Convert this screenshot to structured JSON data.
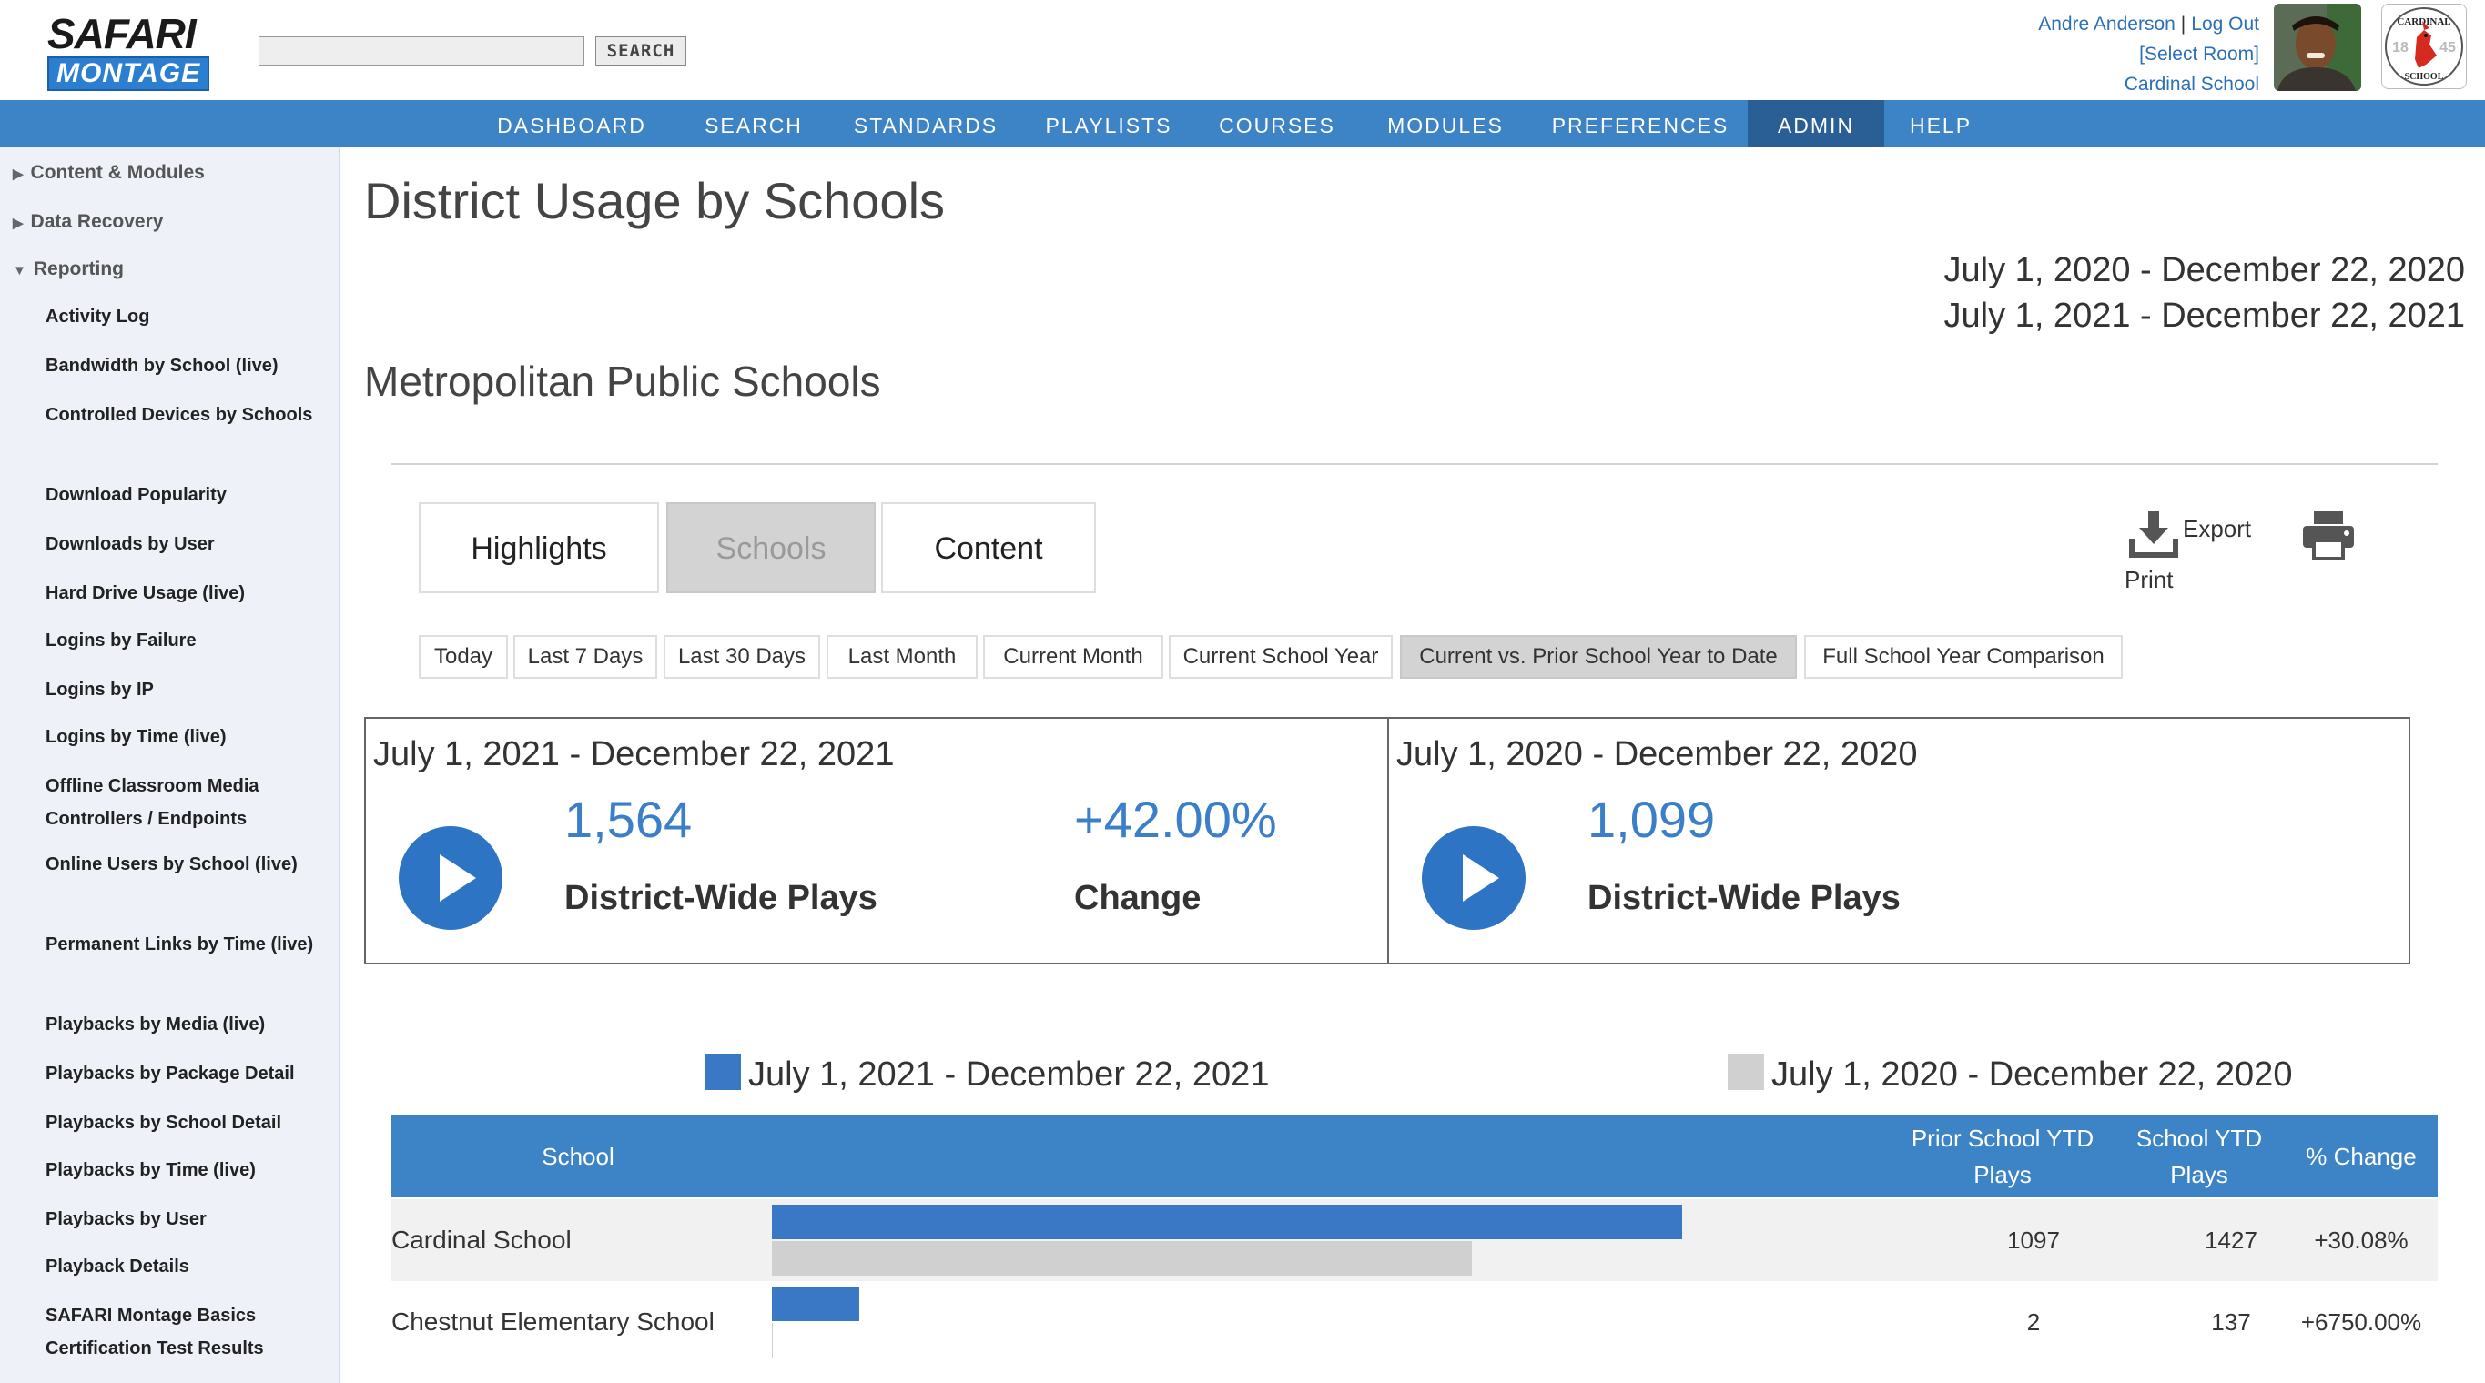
{
  "brand": {
    "line1": "SAFARI",
    "line2": "MONTAGE"
  },
  "header": {
    "search_button": "SEARCH",
    "search_value": "",
    "user_name": "Andre Anderson",
    "separator": "|",
    "logout": "Log Out",
    "select_room": "[Select Room]",
    "school": "Cardinal School",
    "badge_top": "CARDINAL",
    "badge_bottom": "SCHOOL",
    "badge_year_left": "18",
    "badge_year_right": "45"
  },
  "nav": [
    "DASHBOARD",
    "SEARCH",
    "STANDARDS",
    "PLAYLISTS",
    "COURSES",
    "MODULES",
    "PREFERENCES",
    "ADMIN",
    "HELP"
  ],
  "nav_active": "ADMIN",
  "sidebar": {
    "sections": [
      "Content & Modules",
      "Data Recovery",
      "Reporting"
    ],
    "items": [
      "Activity Log",
      "Bandwidth by School (live)",
      "Controlled Devices by Schools",
      "Download Popularity",
      "Downloads by User",
      "Hard Drive Usage (live)",
      "Logins by Failure",
      "Logins by IP",
      "Logins by Time (live)",
      "Offline Classroom Media Controllers / Endpoints",
      "Online Users by School (live)",
      "Permanent Links by Time (live)",
      "Playbacks by Media (live)",
      "Playbacks by Package Detail",
      "Playbacks by School Detail",
      "Playbacks by Time (live)",
      "Playbacks by User",
      "Playback Details",
      "SAFARI Montage Basics Certification Test Results"
    ]
  },
  "page": {
    "title": "District Usage by Schools",
    "range_prior": "July 1, 2020 - December 22, 2020",
    "range_current": "July 1, 2021 - December 22, 2021",
    "district": "Metropolitan Public Schools"
  },
  "tabs": [
    "Highlights",
    "Schools",
    "Content"
  ],
  "active_tab": "Schools",
  "actions": {
    "export": "Export",
    "print": "Print"
  },
  "filters": [
    "Today",
    "Last 7 Days",
    "Last 30 Days",
    "Last Month",
    "Current Month",
    "Current School Year",
    "Current vs. Prior School Year to Date",
    "Full School Year Comparison"
  ],
  "active_filter": "Current vs. Prior School Year to Date",
  "stats": {
    "current": {
      "range": "July 1, 2021 - December 22, 2021",
      "plays": "1,564",
      "plays_label": "District-Wide Plays",
      "change": "+42.00%",
      "change_label": "Change"
    },
    "prior": {
      "range": "July 1, 2020 - December 22, 2020",
      "plays": "1,099",
      "plays_label": "District-Wide Plays"
    }
  },
  "table": {
    "columns": [
      "School",
      "Prior School YTD Plays",
      "School YTD Plays",
      "% Change"
    ],
    "rows": [
      {
        "school": "Cardinal School",
        "prior": "1097",
        "current": "1427",
        "change": "+30.08%"
      },
      {
        "school": "Chestnut Elementary School",
        "prior": "2",
        "current": "137",
        "change": "+6750.00%"
      }
    ]
  },
  "chart_data": {
    "type": "bar",
    "categories": [
      "Cardinal School",
      "Chestnut Elementary School"
    ],
    "series": [
      {
        "name": "July 1, 2021 - December 22, 2021",
        "values": [
          1427,
          137
        ],
        "color": "#3a78c6"
      },
      {
        "name": "July 1, 2020 - December 22, 2020",
        "values": [
          1097,
          2
        ],
        "color": "#d0d0d0"
      }
    ],
    "orientation": "horizontal",
    "legend": "top"
  },
  "colors": {
    "accent": "#3d84c6",
    "nav_active": "#2a5f95",
    "number": "#3a7fc8"
  }
}
